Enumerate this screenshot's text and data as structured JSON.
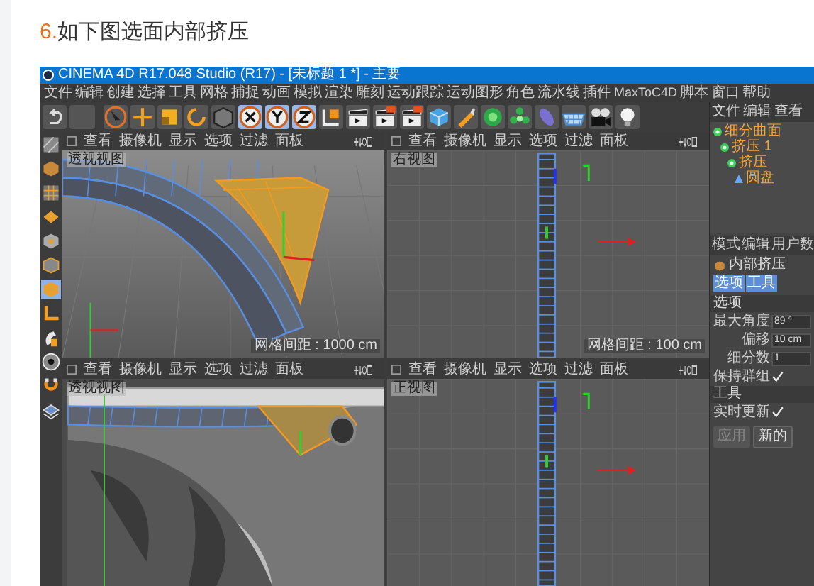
{
  "heading": {
    "number": "6.",
    "text": "如下图选面内部挤压"
  },
  "window": {
    "title": "CINEMA 4D R17.048 Studio (R17) - [未标题 1 *] - 主要"
  },
  "menu": [
    "文件",
    "编辑",
    "创建",
    "选择",
    "工具",
    "网格",
    "捕捉",
    "动画",
    "模拟",
    "渲染",
    "雕刻",
    "运动跟踪",
    "运动图形",
    "角色",
    "流水线",
    "插件",
    "MaxToC4D",
    "脚本",
    "窗口",
    "帮助"
  ],
  "viewports": [
    {
      "kind": "perspective_frame",
      "menu": [
        "查看",
        "摄像机",
        "显示",
        "选项",
        "过滤",
        "面板"
      ],
      "label": "透视视图",
      "grid": "网格间距 : 1000 cm"
    },
    {
      "kind": "side_strip",
      "menu": [
        "查看",
        "摄像机",
        "显示",
        "选项",
        "过滤",
        "面板"
      ],
      "label": "右视图",
      "grid": "网格间距 : 100 cm"
    },
    {
      "kind": "perspective_fan",
      "menu": [
        "查看",
        "摄像机",
        "显示",
        "选项",
        "过滤",
        "面板"
      ],
      "label": "透视视图"
    },
    {
      "kind": "side_strip",
      "menu": [
        "查看",
        "摄像机",
        "显示",
        "选项",
        "过滤",
        "面板"
      ],
      "label": "正视图"
    }
  ],
  "object_manager": {
    "menu": [
      "文件",
      "编辑",
      "查看"
    ],
    "objects": [
      {
        "name": "细分曲面",
        "kind": "generator",
        "children": [
          {
            "name": "挤压 1",
            "kind": "generator",
            "children": [
              {
                "name": "挤压",
                "kind": "generator",
                "children": [
                  {
                    "name": "圆盘",
                    "kind": "polygon"
                  }
                ]
              }
            ]
          }
        ]
      }
    ]
  },
  "attributes": {
    "menu": [
      "模式",
      "编辑",
      "用户数"
    ],
    "title": "内部挤压",
    "tabs": [
      {
        "label": "选项",
        "selected": true
      },
      {
        "label": "工具",
        "selected": true
      }
    ],
    "sections": [
      {
        "title": "选项",
        "rows": [
          {
            "kind": "field",
            "label": "最大角度",
            "value": "89 °"
          },
          {
            "kind": "field",
            "label": "偏移",
            "value": "10 cm"
          },
          {
            "kind": "field",
            "label": "细分数",
            "value": "1"
          },
          {
            "kind": "checkbox",
            "label": "保持群组",
            "checked": true
          }
        ]
      },
      {
        "title": "工具",
        "rows": [
          {
            "kind": "checkbox",
            "label": "实时更新",
            "checked": true
          }
        ]
      }
    ],
    "buttons": [
      {
        "label": "应用",
        "disabled": true
      },
      {
        "label": "新的",
        "disabled": false
      }
    ]
  }
}
